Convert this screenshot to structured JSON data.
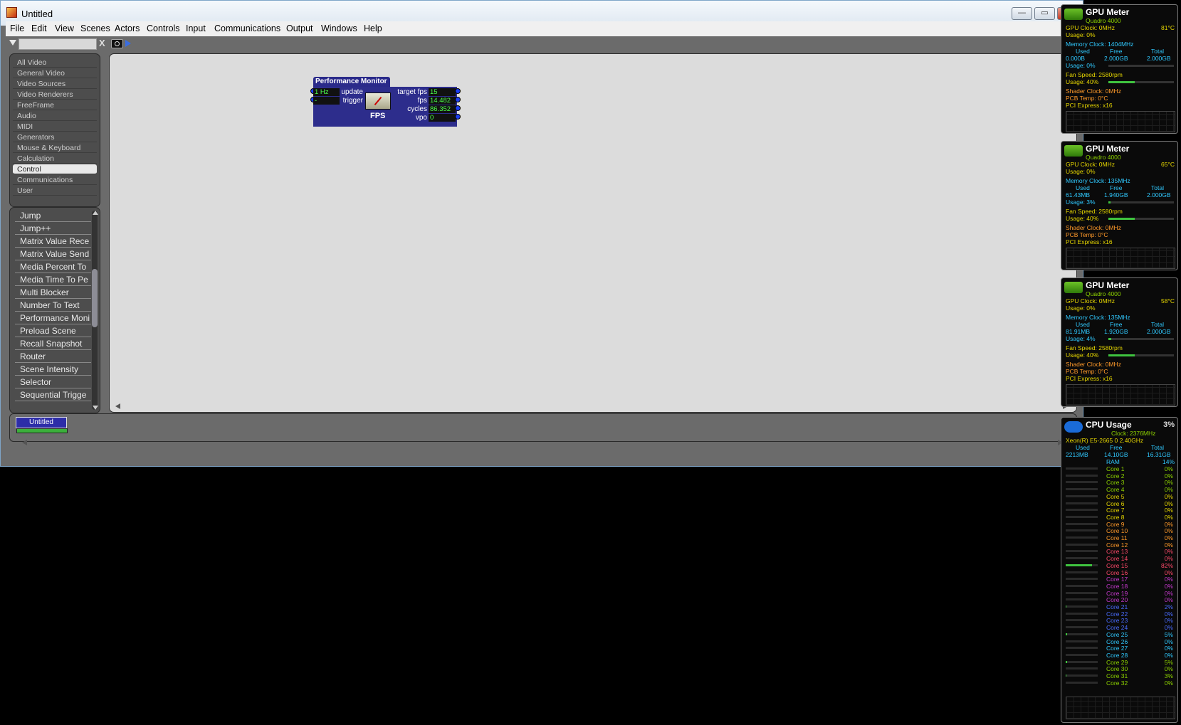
{
  "window": {
    "title": "Untitled",
    "min_label": "—",
    "max_label": "▭",
    "close_label": "✕"
  },
  "menu": [
    "File",
    "Edit",
    "View",
    "Scenes",
    "Actors",
    "Controls",
    "Input",
    "Communications",
    "Output",
    "Windows",
    "Help"
  ],
  "search": {
    "value": "",
    "clear_label": "X"
  },
  "categories": [
    "All Video",
    "General Video",
    "Video Sources",
    "Video Renderers",
    "FreeFrame",
    "Audio",
    "MIDI",
    "Generators",
    "Mouse & Keyboard",
    "Calculation",
    "Control",
    "Communications",
    "User"
  ],
  "selected_category": "Control",
  "actors": [
    "Jump",
    "Jump++",
    "Matrix Value Rece",
    "Matrix Value Send",
    "Media Percent To",
    "Media Time To Pe",
    "Multi Blocker",
    "Number To Text",
    "Performance Moni",
    "Preload Scene",
    "Recall Snapshot",
    "Router",
    "Scene Intensity",
    "Selector",
    "Sequential Trigge"
  ],
  "node": {
    "title": "Performance Monitor",
    "inputs": [
      {
        "value": "1 Hz",
        "label": "update"
      },
      {
        "value": "-",
        "label": "trigger"
      }
    ],
    "outputs": [
      {
        "label": "target fps",
        "value": "15"
      },
      {
        "label": "fps",
        "value": "14.482"
      },
      {
        "label": "cycles",
        "value": "86.352"
      },
      {
        "label": "vpo",
        "value": "0"
      }
    ],
    "icon_label": "FPS"
  },
  "scene_tab": "Untitled",
  "gpu_meters": [
    {
      "title": "GPU Meter",
      "model": "Quadro 4000",
      "gpu_clock": "GPU Clock: 0MHz",
      "temp": "81°C",
      "usage": "Usage: 0%",
      "mem_clock": "Memory Clock: 1404MHz",
      "hdr_used": "Used",
      "hdr_free": "Free",
      "hdr_total": "Total",
      "used": "0.000B",
      "free": "2.000GB",
      "total": "2.000GB",
      "mem_usage": "Usage: 0%",
      "fan": "Fan Speed: 2580rpm",
      "fan_usage": "Usage: 40%",
      "fan_frac": 0.4,
      "mem_frac": 0.0,
      "shader": "Shader Clock: 0MHz",
      "pcb": "PCB Temp: 0°C",
      "pci": "PCI Express: x16"
    },
    {
      "title": "GPU Meter",
      "model": "Quadro 4000",
      "gpu_clock": "GPU Clock: 0MHz",
      "temp": "65°C",
      "usage": "Usage: 0%",
      "mem_clock": "Memory Clock: 135MHz",
      "hdr_used": "Used",
      "hdr_free": "Free",
      "hdr_total": "Total",
      "used": "61.43MB",
      "free": "1.940GB",
      "total": "2.000GB",
      "mem_usage": "Usage: 3%",
      "fan": "Fan Speed: 2580rpm",
      "fan_usage": "Usage: 40%",
      "fan_frac": 0.4,
      "mem_frac": 0.03,
      "shader": "Shader Clock: 0MHz",
      "pcb": "PCB Temp: 0°C",
      "pci": "PCI Express: x16"
    },
    {
      "title": "GPU Meter",
      "model": "Quadro 4000",
      "gpu_clock": "GPU Clock: 0MHz",
      "temp": "58°C",
      "usage": "Usage: 0%",
      "mem_clock": "Memory Clock: 135MHz",
      "hdr_used": "Used",
      "hdr_free": "Free",
      "hdr_total": "Total",
      "used": "81.91MB",
      "free": "1.920GB",
      "total": "2.000GB",
      "mem_usage": "Usage: 4%",
      "fan": "Fan Speed: 2580rpm",
      "fan_usage": "Usage: 40%",
      "fan_frac": 0.4,
      "mem_frac": 0.04,
      "shader": "Shader Clock: 0MHz",
      "pcb": "PCB Temp: 0°C",
      "pci": "PCI Express: x16"
    }
  ],
  "cpu": {
    "title": "CPU Usage",
    "usage": "3%",
    "clock": "Clock: 2376MHz",
    "model": "Xeon(R) E5-2665 0 2.40GHz",
    "hdr_used": "Used",
    "hdr_free": "Free",
    "hdr_total": "Total",
    "used": "2213MB",
    "free": "14.10GB",
    "total": "16.31GB",
    "ram_label": "RAM",
    "ram_value": "14%",
    "cores": [
      {
        "name": "Core 1",
        "value": "0%"
      },
      {
        "name": "Core 2",
        "value": "0%"
      },
      {
        "name": "Core 3",
        "value": "0%"
      },
      {
        "name": "Core 4",
        "value": "0%"
      },
      {
        "name": "Core 5",
        "value": "0%"
      },
      {
        "name": "Core 6",
        "value": "0%"
      },
      {
        "name": "Core 7",
        "value": "0%"
      },
      {
        "name": "Core 8",
        "value": "0%"
      },
      {
        "name": "Core 9",
        "value": "0%"
      },
      {
        "name": "Core 10",
        "value": "0%"
      },
      {
        "name": "Core 11",
        "value": "0%"
      },
      {
        "name": "Core 12",
        "value": "0%"
      },
      {
        "name": "Core 13",
        "value": "0%"
      },
      {
        "name": "Core 14",
        "value": "0%"
      },
      {
        "name": "Core 15",
        "value": "82%"
      },
      {
        "name": "Core 16",
        "value": "0%"
      },
      {
        "name": "Core 17",
        "value": "0%"
      },
      {
        "name": "Core 18",
        "value": "0%"
      },
      {
        "name": "Core 19",
        "value": "0%"
      },
      {
        "name": "Core 20",
        "value": "0%"
      },
      {
        "name": "Core 21",
        "value": "2%"
      },
      {
        "name": "Core 22",
        "value": "0%"
      },
      {
        "name": "Core 23",
        "value": "0%"
      },
      {
        "name": "Core 24",
        "value": "0%"
      },
      {
        "name": "Core 25",
        "value": "5%"
      },
      {
        "name": "Core 26",
        "value": "0%"
      },
      {
        "name": "Core 27",
        "value": "0%"
      },
      {
        "name": "Core 28",
        "value": "0%"
      },
      {
        "name": "Core 29",
        "value": "5%"
      },
      {
        "name": "Core 30",
        "value": "0%"
      },
      {
        "name": "Core 31",
        "value": "3%"
      },
      {
        "name": "Core 32",
        "value": "0%"
      }
    ],
    "core_colors": [
      "#8fd400",
      "#e7d700",
      "#ff9a2a",
      "#ff4a6a",
      "#c83ad0",
      "#4a6cff",
      "#30c9ff",
      "#8fd400"
    ]
  }
}
